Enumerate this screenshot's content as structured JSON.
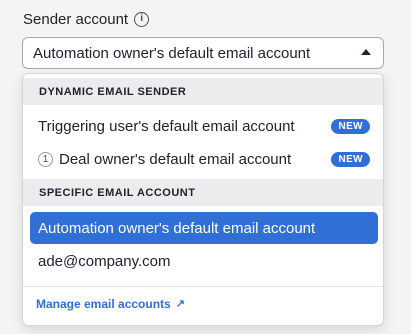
{
  "field": {
    "label": "Sender account",
    "info_icon": "i",
    "selected_value": "Automation owner's default email account"
  },
  "dropdown": {
    "sections": [
      {
        "header": "DYNAMIC EMAIL SENDER",
        "options": [
          {
            "label": "Triggering user's default email account",
            "badge": "NEW"
          },
          {
            "number": "1",
            "label": "Deal owner's default email account",
            "badge": "NEW"
          }
        ]
      },
      {
        "header": "SPECIFIC EMAIL ACCOUNT",
        "options": [
          {
            "label": "Automation owner's default email account",
            "selected": true
          },
          {
            "label": "ade@company.com"
          }
        ]
      }
    ],
    "footer_link": "Manage email accounts",
    "footer_link_icon": "↗"
  },
  "colors": {
    "accent": "#2f6fd6",
    "section_header_bg": "#ececee"
  },
  "icons": {
    "info": "info-icon",
    "caret": "caret-up-icon",
    "external_link": "external-link-icon"
  }
}
